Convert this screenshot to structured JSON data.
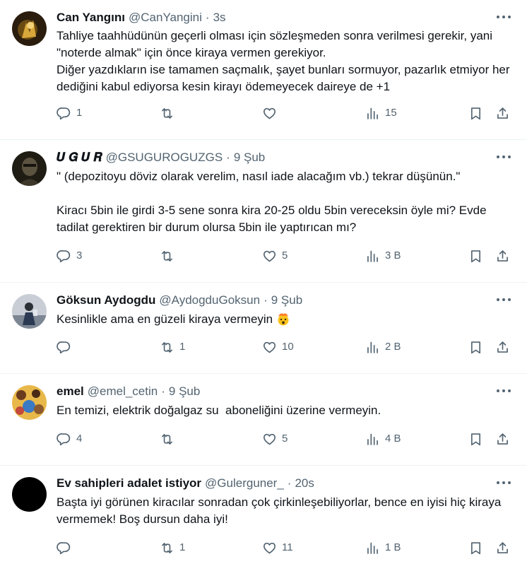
{
  "colors": {
    "text": "#0f1419",
    "secondary": "#536471",
    "divider": "#eff3f4"
  },
  "tweets": [
    {
      "name": "Can Yangını",
      "handle": "@CanYangini",
      "sep": "·",
      "time": "3s",
      "text": "Tahliye taahhüdünün geçerli olması için sözleşmeden sonra verilmesi gerekir, yani \"noterde almak\" için önce kiraya vermen gerekiyor.\nDiğer yazdıkların ise tamamen saçmalık, şayet bunları sormuyor, pazarlık etmiyor her dediğini kabul ediyorsa kesin kirayı ödemeyecek daireye de +1",
      "replies": "1",
      "retweets": "",
      "likes": "",
      "views": "15"
    },
    {
      "name": "𝑼 𝑮 𝑼 𝑹",
      "handle": "@GSUGUROGUZGS",
      "sep": "·",
      "time": "9 Şub",
      "text": "\" (depozitoyu döviz olarak verelim, nasıl iade alacağım vb.) tekrar düşünün.\"\n\nKiracı 5bin ile girdi 3-5 sene sonra kira 20-25 oldu 5bin vereceksin öyle mi? Evde tadilat gerektiren bir durum olursa 5bin ile yaptırıcan mı?",
      "replies": "3",
      "retweets": "",
      "likes": "5",
      "views": "3 B"
    },
    {
      "name": "Göksun Aydogdu",
      "handle": "@AydogduGoksun",
      "sep": "·",
      "time": "9 Şub",
      "text": "Kesinlikle ama en güzeli kiraya vermeyin",
      "emoji": "exploding-head-emoji",
      "replies": "",
      "retweets": "1",
      "likes": "10",
      "views": "2 B"
    },
    {
      "name": "emel",
      "handle": "@emel_cetin",
      "sep": "·",
      "time": "9 Şub",
      "text": "En temizi, elektrik doğalgaz su  aboneliğini üzerine vermeyin.",
      "replies": "4",
      "retweets": "",
      "likes": "5",
      "views": "4 B"
    },
    {
      "name": "Ev sahipleri adalet istiyor",
      "handle": "@Gulerguner_",
      "sep": "·",
      "time": "20s",
      "text": "Başta iyi görünen kiracılar sonradan çok çirkinleşebiliyorlar, bence en iyisi hiç kiraya vermemek! Boş dursun daha iyi!",
      "replies": "",
      "retweets": "1",
      "likes": "11",
      "views": "1 B"
    }
  ]
}
